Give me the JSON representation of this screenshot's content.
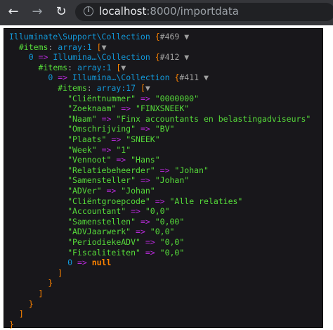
{
  "browser": {
    "url_host": "localhost",
    "url_path": ":8000/importdata"
  },
  "dump": {
    "lines": [
      [
        {
          "t": "Illuminate\\Support\\Collection ",
          "c": "class"
        },
        {
          "t": "{",
          "c": "brace"
        },
        {
          "t": "#469",
          "c": "dim"
        },
        {
          "t": " ▼",
          "c": "dim"
        }
      ],
      [
        {
          "t": "  ",
          "c": "dim"
        },
        {
          "t": "#items",
          "c": "key"
        },
        {
          "t": ": ",
          "c": "dim"
        },
        {
          "t": "array:1",
          "c": "note"
        },
        {
          "t": " [",
          "c": "brace"
        },
        {
          "t": "▼",
          "c": "dim"
        }
      ],
      [
        {
          "t": "    0 ",
          "c": "note"
        },
        {
          "t": "=>",
          "c": "op"
        },
        {
          "t": " Illumina…\\Collection ",
          "c": "class"
        },
        {
          "t": "{",
          "c": "brace"
        },
        {
          "t": "#412",
          "c": "dim"
        },
        {
          "t": " ▼",
          "c": "dim"
        }
      ],
      [
        {
          "t": "      ",
          "c": "dim"
        },
        {
          "t": "#items",
          "c": "key"
        },
        {
          "t": ": ",
          "c": "dim"
        },
        {
          "t": "array:1",
          "c": "note"
        },
        {
          "t": " [",
          "c": "brace"
        },
        {
          "t": "▼",
          "c": "dim"
        }
      ],
      [
        {
          "t": "        0 ",
          "c": "note"
        },
        {
          "t": "=>",
          "c": "op"
        },
        {
          "t": " Illumina…\\Collection ",
          "c": "class"
        },
        {
          "t": "{",
          "c": "brace"
        },
        {
          "t": "#411",
          "c": "dim"
        },
        {
          "t": " ▼",
          "c": "dim"
        }
      ],
      [
        {
          "t": "          ",
          "c": "dim"
        },
        {
          "t": "#items",
          "c": "key"
        },
        {
          "t": ": ",
          "c": "dim"
        },
        {
          "t": "array:17",
          "c": "note"
        },
        {
          "t": " [",
          "c": "brace"
        },
        {
          "t": "▼",
          "c": "dim"
        }
      ],
      [
        {
          "t": "            \"Cliëntnummer\" ",
          "c": "str"
        },
        {
          "t": "=>",
          "c": "op"
        },
        {
          "t": " \"0000000\"",
          "c": "str"
        }
      ],
      [
        {
          "t": "            \"Zoeknaam\" ",
          "c": "str"
        },
        {
          "t": "=>",
          "c": "op"
        },
        {
          "t": " \"FINXSNEEK\"",
          "c": "str"
        }
      ],
      [
        {
          "t": "            \"Naam\" ",
          "c": "str"
        },
        {
          "t": "=>",
          "c": "op"
        },
        {
          "t": " \"Finx accountants en belastingadviseurs\"",
          "c": "str"
        }
      ],
      [
        {
          "t": "            \"Omschrijving\" ",
          "c": "str"
        },
        {
          "t": "=>",
          "c": "op"
        },
        {
          "t": " \"BV\"",
          "c": "str"
        }
      ],
      [
        {
          "t": "            \"Plaats\" ",
          "c": "str"
        },
        {
          "t": "=>",
          "c": "op"
        },
        {
          "t": " \"SNEEK\"",
          "c": "str"
        }
      ],
      [
        {
          "t": "            \"Week\" ",
          "c": "str"
        },
        {
          "t": "=>",
          "c": "op"
        },
        {
          "t": " \"1\"",
          "c": "str"
        }
      ],
      [
        {
          "t": "            \"Vennoot\" ",
          "c": "str"
        },
        {
          "t": "=>",
          "c": "op"
        },
        {
          "t": " \"Hans\"",
          "c": "str"
        }
      ],
      [
        {
          "t": "            \"Relatiebeheerder\" ",
          "c": "str"
        },
        {
          "t": "=>",
          "c": "op"
        },
        {
          "t": " \"Johan\"",
          "c": "str"
        }
      ],
      [
        {
          "t": "            \"Samensteller\" ",
          "c": "str"
        },
        {
          "t": "=>",
          "c": "op"
        },
        {
          "t": " \"Johan\"",
          "c": "str"
        }
      ],
      [
        {
          "t": "            \"ADVer\" ",
          "c": "str"
        },
        {
          "t": "=>",
          "c": "op"
        },
        {
          "t": " \"Johan\"",
          "c": "str"
        }
      ],
      [
        {
          "t": "            \"Cliëntgroepcode\" ",
          "c": "str"
        },
        {
          "t": "=>",
          "c": "op"
        },
        {
          "t": " \"Alle relaties\"",
          "c": "str"
        }
      ],
      [
        {
          "t": "            \"Accountant\" ",
          "c": "str"
        },
        {
          "t": "=>",
          "c": "op"
        },
        {
          "t": " \"0,0\"",
          "c": "str"
        }
      ],
      [
        {
          "t": "            \"Samenstellen\" ",
          "c": "str"
        },
        {
          "t": "=>",
          "c": "op"
        },
        {
          "t": " \"0,00\"",
          "c": "str"
        }
      ],
      [
        {
          "t": "            \"ADVJaarwerk\" ",
          "c": "str"
        },
        {
          "t": "=>",
          "c": "op"
        },
        {
          "t": " \"0,0\"",
          "c": "str"
        }
      ],
      [
        {
          "t": "            \"PeriodiekeADV\" ",
          "c": "str"
        },
        {
          "t": "=>",
          "c": "op"
        },
        {
          "t": " \"0,0\"",
          "c": "str"
        }
      ],
      [
        {
          "t": "            \"Fiscaliteiten\" ",
          "c": "str"
        },
        {
          "t": "=>",
          "c": "op"
        },
        {
          "t": " \"0,0\"",
          "c": "str"
        }
      ],
      [
        {
          "t": "            0 ",
          "c": "note"
        },
        {
          "t": "=>",
          "c": "op"
        },
        {
          "t": " null",
          "c": "null"
        }
      ],
      [
        {
          "t": "          ]",
          "c": "brace"
        }
      ],
      [
        {
          "t": "        }",
          "c": "brace"
        }
      ],
      [
        {
          "t": "      ]",
          "c": "brace"
        }
      ],
      [
        {
          "t": "    }",
          "c": "brace"
        }
      ],
      [
        {
          "t": "  ]",
          "c": "brace"
        }
      ],
      [
        {
          "t": "}",
          "c": "brace"
        }
      ]
    ]
  }
}
